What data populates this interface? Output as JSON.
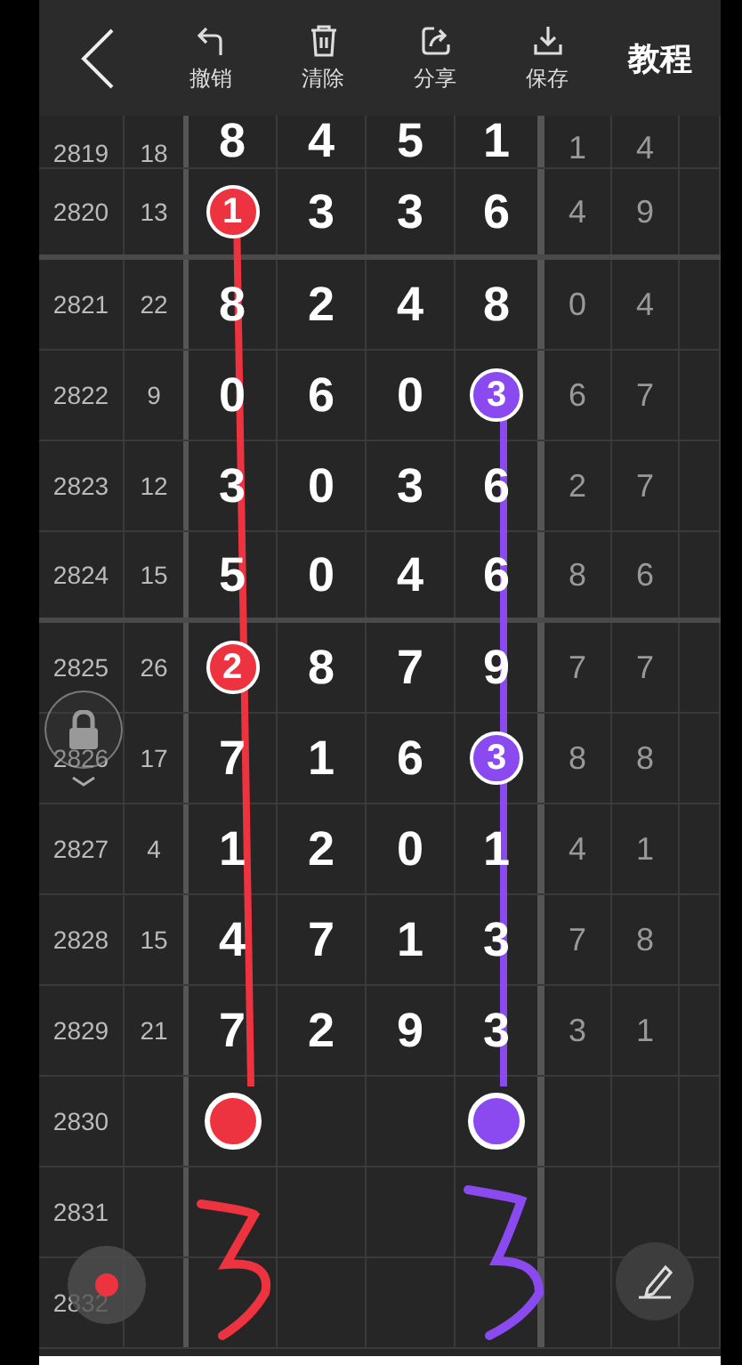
{
  "header": {
    "actions": [
      {
        "kind": "undo",
        "label": "撤销"
      },
      {
        "kind": "clear",
        "label": "清除"
      },
      {
        "kind": "share",
        "label": "分享"
      },
      {
        "kind": "save",
        "label": "保存"
      }
    ],
    "tutorial": "教程"
  },
  "rows": [
    {
      "period": "2819",
      "sum": "18",
      "cells": [
        {
          "kind": "digit",
          "text": "8"
        },
        {
          "kind": "digit",
          "text": "4"
        },
        {
          "kind": "digit",
          "text": "5"
        },
        {
          "kind": "digit",
          "text": "1"
        }
      ],
      "extras": [
        "1",
        "4"
      ],
      "divider_below": false
    },
    {
      "period": "2820",
      "sum": "13",
      "cells": [
        {
          "kind": "circle",
          "text": "1",
          "color": "#ee3340"
        },
        {
          "kind": "digit",
          "text": "3"
        },
        {
          "kind": "digit",
          "text": "3"
        },
        {
          "kind": "digit",
          "text": "6"
        }
      ],
      "extras": [
        "4",
        "9"
      ],
      "divider_below": true
    },
    {
      "period": "2821",
      "sum": "22",
      "cells": [
        {
          "kind": "digit",
          "text": "8"
        },
        {
          "kind": "digit",
          "text": "2"
        },
        {
          "kind": "digit",
          "text": "4"
        },
        {
          "kind": "digit",
          "text": "8"
        }
      ],
      "extras": [
        "0",
        "4"
      ],
      "divider_below": false
    },
    {
      "period": "2822",
      "sum": "9",
      "cells": [
        {
          "kind": "digit",
          "text": "0"
        },
        {
          "kind": "digit",
          "text": "6"
        },
        {
          "kind": "digit",
          "text": "0"
        },
        {
          "kind": "circle",
          "text": "3",
          "color": "#8a4af0"
        }
      ],
      "extras": [
        "6",
        "7"
      ],
      "divider_below": false
    },
    {
      "period": "2823",
      "sum": "12",
      "cells": [
        {
          "kind": "digit",
          "text": "3"
        },
        {
          "kind": "digit",
          "text": "0"
        },
        {
          "kind": "digit",
          "text": "3"
        },
        {
          "kind": "digit",
          "text": "6"
        }
      ],
      "extras": [
        "2",
        "7"
      ],
      "divider_below": false
    },
    {
      "period": "2824",
      "sum": "15",
      "cells": [
        {
          "kind": "digit",
          "text": "5"
        },
        {
          "kind": "digit",
          "text": "0"
        },
        {
          "kind": "digit",
          "text": "4"
        },
        {
          "kind": "digit",
          "text": "6"
        }
      ],
      "extras": [
        "8",
        "6"
      ],
      "divider_below": true
    },
    {
      "period": "2825",
      "sum": "26",
      "cells": [
        {
          "kind": "circle",
          "text": "2",
          "color": "#ee3340"
        },
        {
          "kind": "digit",
          "text": "8"
        },
        {
          "kind": "digit",
          "text": "7"
        },
        {
          "kind": "digit",
          "text": "9"
        }
      ],
      "extras": [
        "7",
        "7"
      ],
      "divider_below": false
    },
    {
      "period": "2826",
      "sum": "17",
      "cells": [
        {
          "kind": "digit",
          "text": "7"
        },
        {
          "kind": "digit",
          "text": "1"
        },
        {
          "kind": "digit",
          "text": "6"
        },
        {
          "kind": "circle",
          "text": "3",
          "color": "#8a4af0"
        }
      ],
      "extras": [
        "8",
        "8"
      ],
      "divider_below": false
    },
    {
      "period": "2827",
      "sum": "4",
      "cells": [
        {
          "kind": "digit",
          "text": "1"
        },
        {
          "kind": "digit",
          "text": "2"
        },
        {
          "kind": "digit",
          "text": "0"
        },
        {
          "kind": "digit",
          "text": "1"
        }
      ],
      "extras": [
        "4",
        "1"
      ],
      "divider_below": false
    },
    {
      "period": "2828",
      "sum": "15",
      "cells": [
        {
          "kind": "digit",
          "text": "4"
        },
        {
          "kind": "digit",
          "text": "7"
        },
        {
          "kind": "digit",
          "text": "1"
        },
        {
          "kind": "digit",
          "text": "3"
        }
      ],
      "extras": [
        "7",
        "8"
      ],
      "divider_below": false
    },
    {
      "period": "2829",
      "sum": "21",
      "cells": [
        {
          "kind": "digit",
          "text": "7"
        },
        {
          "kind": "digit",
          "text": "2"
        },
        {
          "kind": "digit",
          "text": "9"
        },
        {
          "kind": "digit",
          "text": "3"
        }
      ],
      "extras": [
        "3",
        "1"
      ],
      "divider_below": false
    },
    {
      "period": "2830",
      "cells": [
        {
          "kind": "dot",
          "color": "#ee3340"
        },
        {
          "kind": "blank"
        },
        {
          "kind": "blank"
        },
        {
          "kind": "dot",
          "color": "#8a4af0"
        }
      ],
      "extras": [],
      "divider_below": false
    },
    {
      "period": "2831",
      "cells": [
        {
          "kind": "blank"
        },
        {
          "kind": "blank"
        },
        {
          "kind": "blank"
        },
        {
          "kind": "blank"
        }
      ],
      "extras": [],
      "divider_below": false
    },
    {
      "period": "2832",
      "cells": [
        {
          "kind": "blank"
        },
        {
          "kind": "blank"
        },
        {
          "kind": "blank"
        },
        {
          "kind": "blank"
        }
      ],
      "extras": [],
      "divider_below": false
    }
  ]
}
